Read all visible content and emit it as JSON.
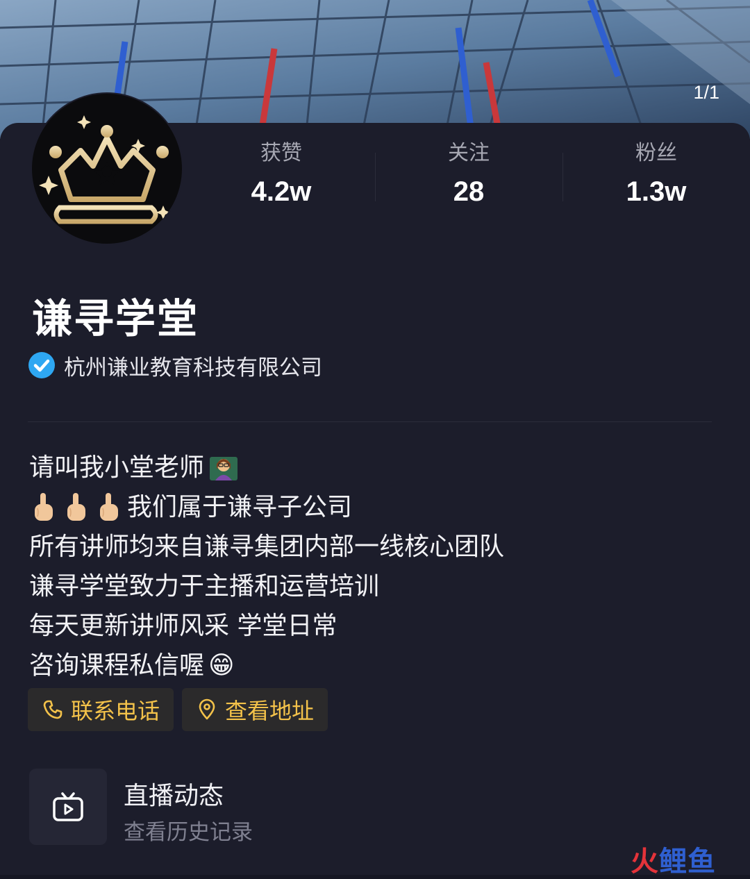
{
  "header": {
    "page_indicator": "1/1"
  },
  "profile": {
    "name": "谦寻学堂",
    "verified_company": "杭州谦业教育科技有限公司",
    "verified_color": "#2ea7f2",
    "avatar_icon": "crown-book-logo"
  },
  "stats": [
    {
      "label": "获赞",
      "value": "4.2w"
    },
    {
      "label": "关注",
      "value": "28"
    },
    {
      "label": "粉丝",
      "value": "1.3w"
    }
  ],
  "bio": {
    "line1": "请叫我小堂老师",
    "line1_emoji": "teacher-emoji",
    "line2": "我们属于谦寻子公司",
    "line2_emoji": "pointing-hand-emoji",
    "line3": "所有讲师均来自谦寻集团内部一线核心团队",
    "line4": "谦寻学堂致力于主播和运营培训",
    "line5": "每天更新讲师风采 学堂日常",
    "line6": "咨询课程私信喔",
    "line6_emoji": "😁"
  },
  "actions": {
    "phone_label": "联系电话",
    "address_label": "查看地址",
    "accent_color": "#f3c24a"
  },
  "live": {
    "title": "直播动态",
    "subtitle": "查看历史记录"
  },
  "watermark": {
    "part1": "火",
    "part2": "鲤鱼"
  }
}
